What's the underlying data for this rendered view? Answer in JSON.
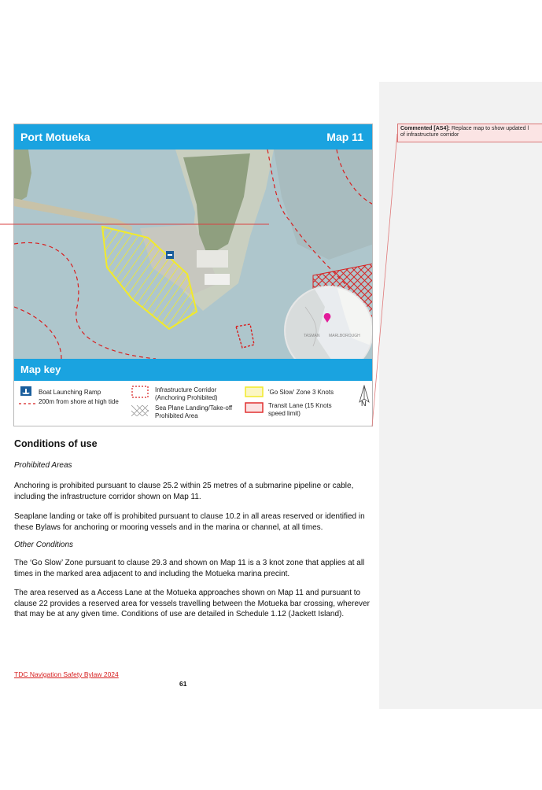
{
  "map": {
    "title": "Port Motueka",
    "number": "Map 11",
    "key_title": "Map key",
    "inset_labels": [
      "TASMAN",
      "MARLBOROUGH"
    ],
    "north_label": "N",
    "colors": {
      "header": "#1aa3e0",
      "water": "#a9c3c9",
      "land": "#c9cfc0",
      "go_slow": "#f2ea2a",
      "transit": "#e03030",
      "corridor": "#d82020",
      "marker": "#e21b9a"
    },
    "legend": [
      {
        "icon": "boat-ramp-icon",
        "label": "Boat Launching Ramp"
      },
      {
        "icon": "dashed-shore-line-icon",
        "label": "200m from shore at high tide"
      },
      {
        "icon": "corridor-box-icon",
        "label": "Infrastructure Corridor (Anchoring Prohibited)"
      },
      {
        "icon": "crosshatch-icon",
        "label": "Sea Plane Landing/Take-off Prohibited Area"
      },
      {
        "icon": "yellow-zone-icon",
        "label": "'Go Slow' Zone 3 Knots"
      },
      {
        "icon": "red-lane-icon",
        "label": "Transit Lane (15 Knots speed limit)"
      }
    ]
  },
  "comment": {
    "author": "Commented [AS4]:",
    "text": "Replace map to show updated l",
    "text2": "of infrastructure corridor"
  },
  "content": {
    "heading": "Conditions of use",
    "sub1": "Prohibited Areas",
    "p1": "Anchoring is prohibited pursuant to clause 25.2 within 25 metres of a submarine pipeline or cable, including the infrastructure corridor shown on Map 11.",
    "p2": "Seaplane landing or take off is prohibited pursuant to clause 10.2 in all areas reserved or identified in these Bylaws for anchoring or mooring vessels and in the marina or channel, at all times.",
    "sub2": "Other Conditions",
    "p3": "The ‘Go Slow’ Zone pursuant to clause 29.3 and shown on Map 11 is a 3 knot zone that applies at all times in the marked area adjacent to and including the Motueka marina precint.",
    "p4": "The area reserved as a Access Lane at the Motueka approaches shown on Map 11 and pursuant to clause 22 provides a reserved area for vessels travelling between the Motueka bar crossing, wherever that may be at any given time. Conditions of use are detailed in Schedule 1.12 (Jackett Island)."
  },
  "footer": {
    "link": "TDC Navigation Safety Bylaw 2024",
    "page": "61"
  }
}
